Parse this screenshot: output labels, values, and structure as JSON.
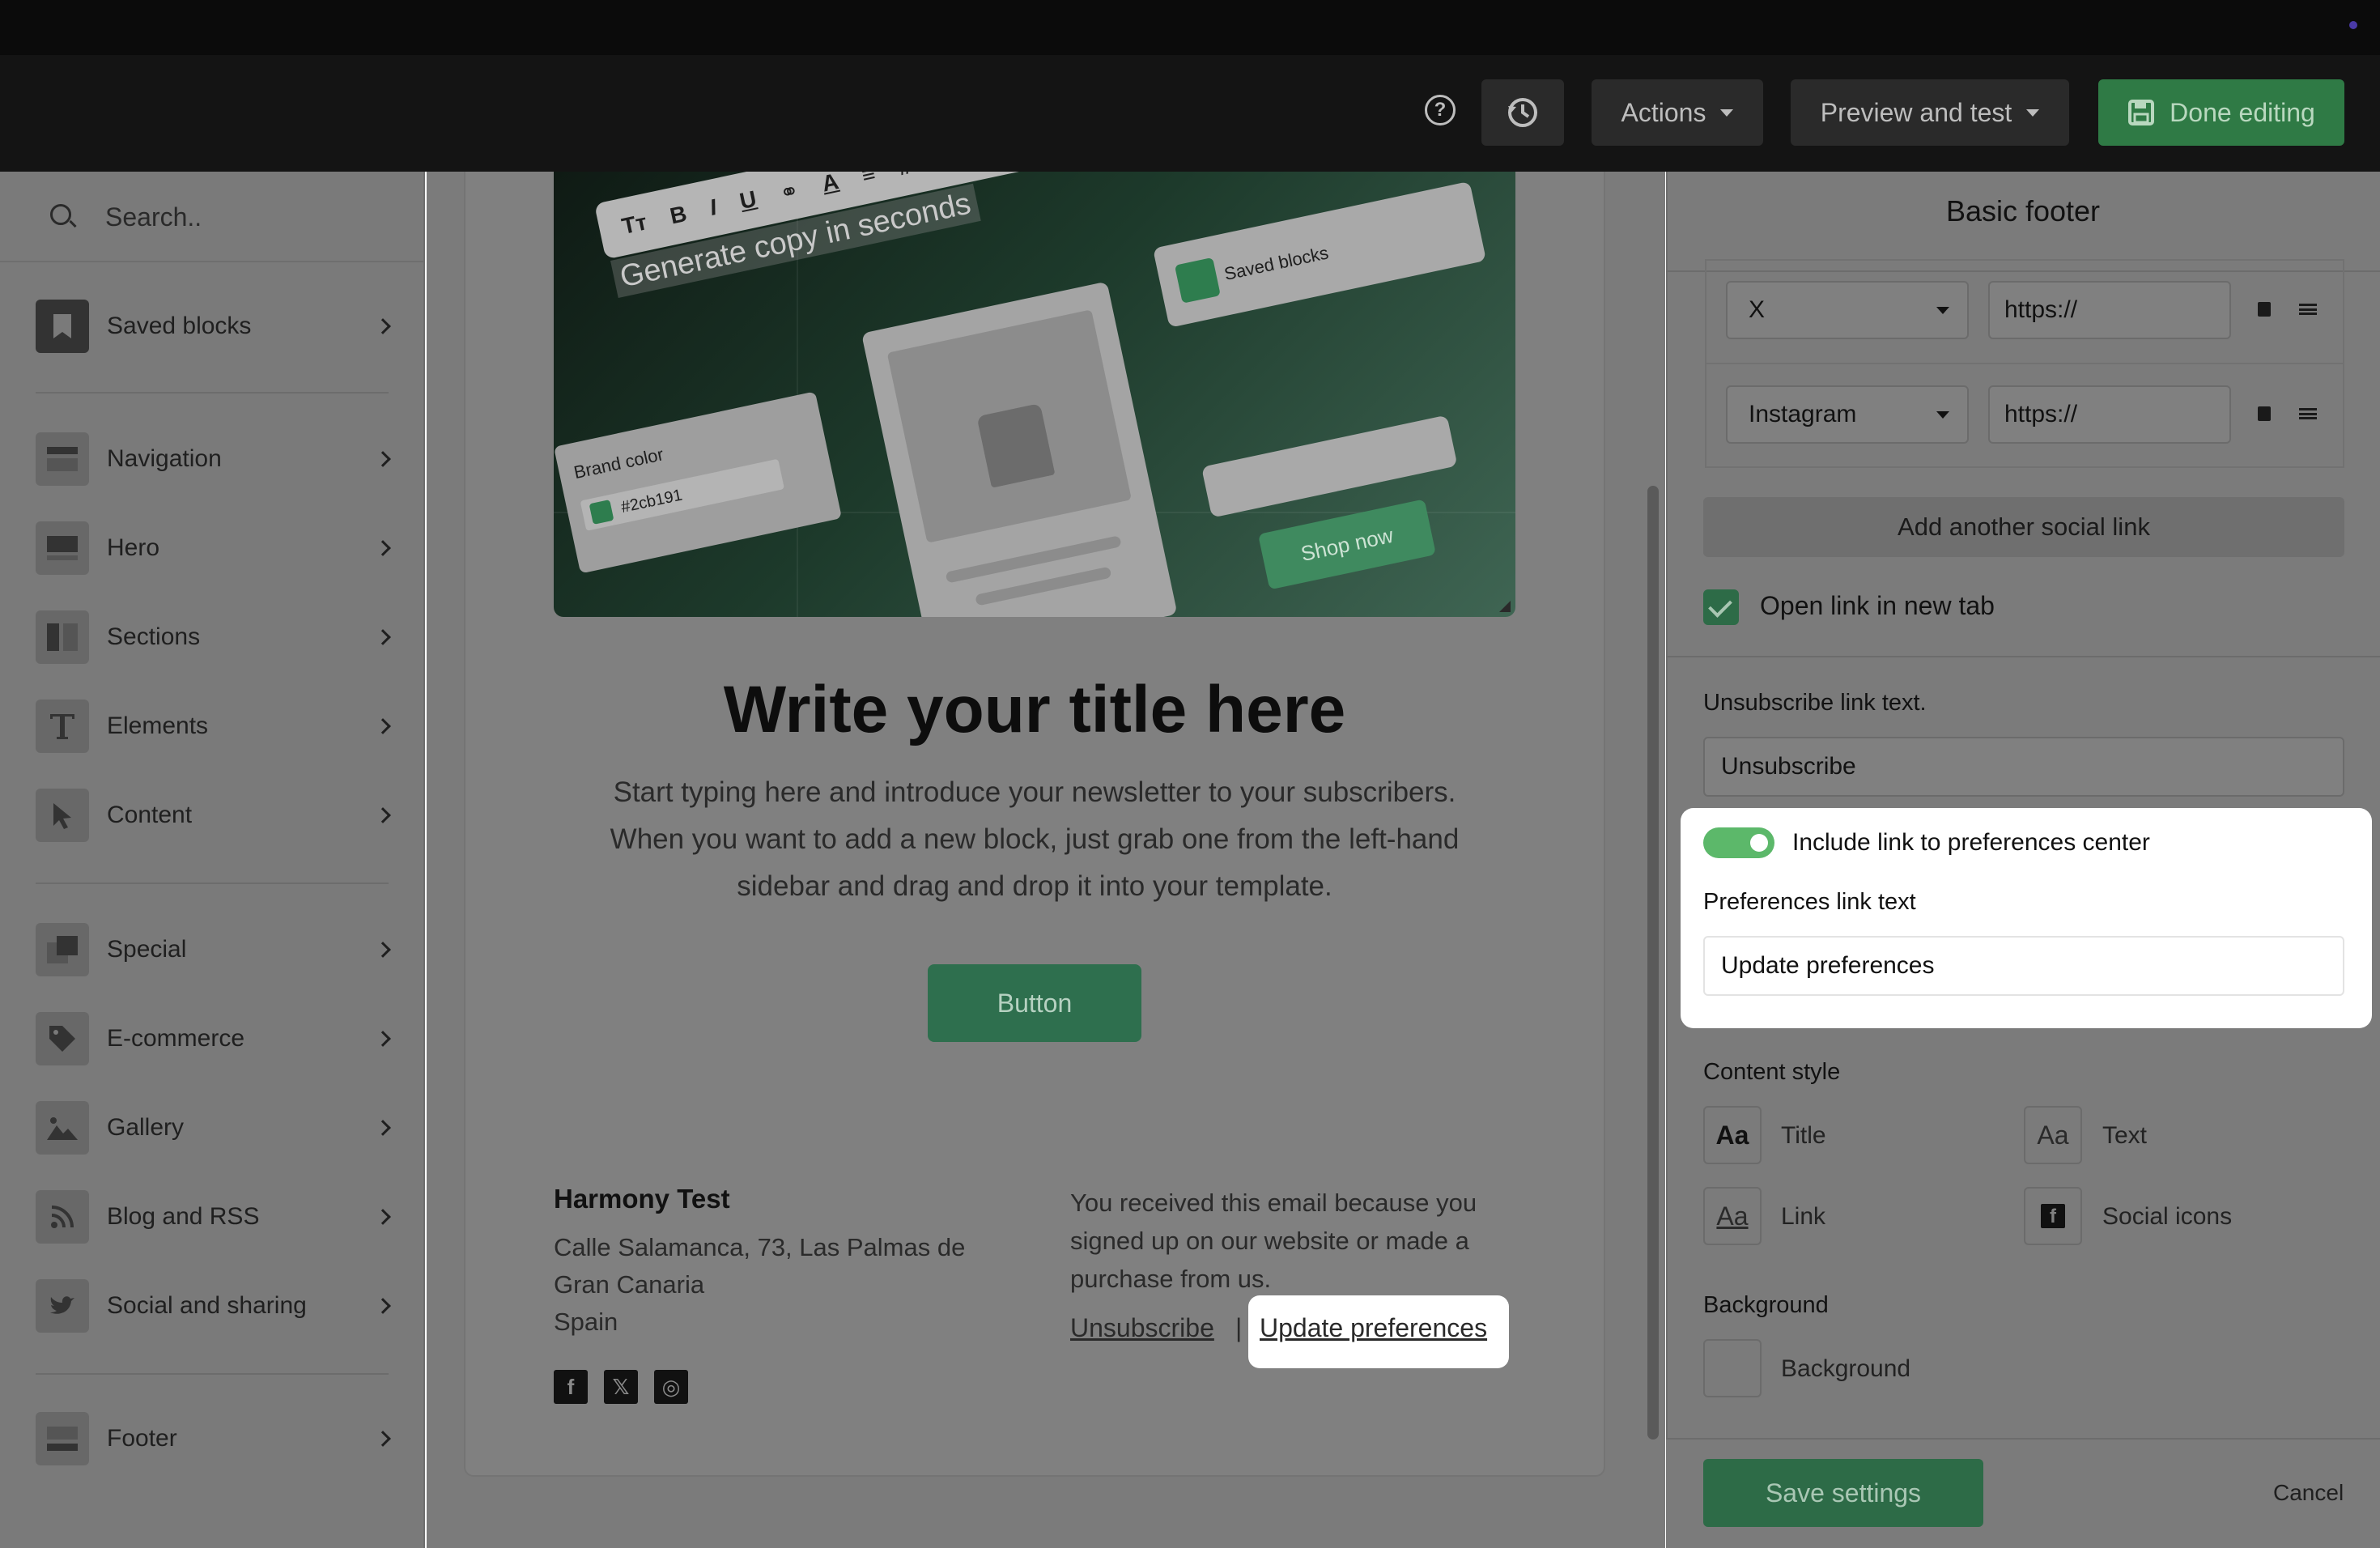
{
  "header": {
    "actions_label": "Actions",
    "preview_label": "Preview and test",
    "done_label": "Done editing"
  },
  "sidebar": {
    "search_placeholder": "Search..",
    "items": [
      {
        "label": "Saved blocks",
        "icon": "bookmark-icon"
      },
      {
        "label": "Navigation",
        "icon": "navigation-icon"
      },
      {
        "label": "Hero",
        "icon": "hero-icon"
      },
      {
        "label": "Sections",
        "icon": "columns-icon"
      },
      {
        "label": "Elements",
        "icon": "text-icon"
      },
      {
        "label": "Content",
        "icon": "pointer-icon"
      },
      {
        "label": "Special",
        "icon": "special-icon"
      },
      {
        "label": "E-commerce",
        "icon": "tag-icon"
      },
      {
        "label": "Gallery",
        "icon": "image-icon"
      },
      {
        "label": "Blog and RSS",
        "icon": "rss-icon"
      },
      {
        "label": "Social and sharing",
        "icon": "twitter-icon"
      },
      {
        "label": "Footer",
        "icon": "footer-icon"
      }
    ]
  },
  "email": {
    "hero": {
      "generate_copy": "Generate copy in seconds",
      "saved_blocks": "Saved blocks",
      "brand_color_label": "Brand color",
      "brand_color_value": "#2cb191",
      "shop_now": "Shop now",
      "brand_color_hex": "#2e7d4e"
    },
    "title": "Write your title here",
    "body_line1": "Start typing here and introduce your newsletter to your subscribers.",
    "body_line2": "When you want to add a new block, just grab one from the left-hand",
    "body_line3": "sidebar and drag and drop it into your template.",
    "button_label": "Button",
    "footer": {
      "company": "Harmony Test",
      "address_line1": "Calle Salamanca, 73, Las Palmas de",
      "address_line2": "Gran Canaria",
      "address_line3": "Spain",
      "notice_line1": "You received this email because you",
      "notice_line2": "signed up on our website or made a",
      "notice_line3": "purchase from us.",
      "unsubscribe": "Unsubscribe",
      "separator": "|",
      "update_preferences": "Update preferences"
    }
  },
  "panel": {
    "title": "Basic footer",
    "social_links": [
      {
        "network": "X",
        "url": "https://"
      },
      {
        "network": "Instagram",
        "url": "https://"
      }
    ],
    "add_social_label": "Add another social link",
    "open_new_tab_label": "Open link in new tab",
    "unsubscribe_label": "Unsubscribe link text.",
    "unsubscribe_value": "Unsubscribe",
    "include_prefs_label": "Include link to preferences center",
    "prefs_text_label": "Preferences link text",
    "prefs_text_value": "Update preferences",
    "content_style_label": "Content style",
    "styles": {
      "title_glyph": "Aa",
      "title_label": "Title",
      "text_glyph": "Aa",
      "text_label": "Text",
      "link_glyph": "Aa",
      "link_label": "Link",
      "social_glyph": "f",
      "social_label": "Social icons"
    },
    "background_heading": "Background",
    "background_label": "Background",
    "save_label": "Save settings",
    "cancel_label": "Cancel"
  },
  "colors": {
    "accent_green": "#2f7a45",
    "toggle_on": "#5cb86a",
    "overlay_gray": "#7b7b7b"
  }
}
